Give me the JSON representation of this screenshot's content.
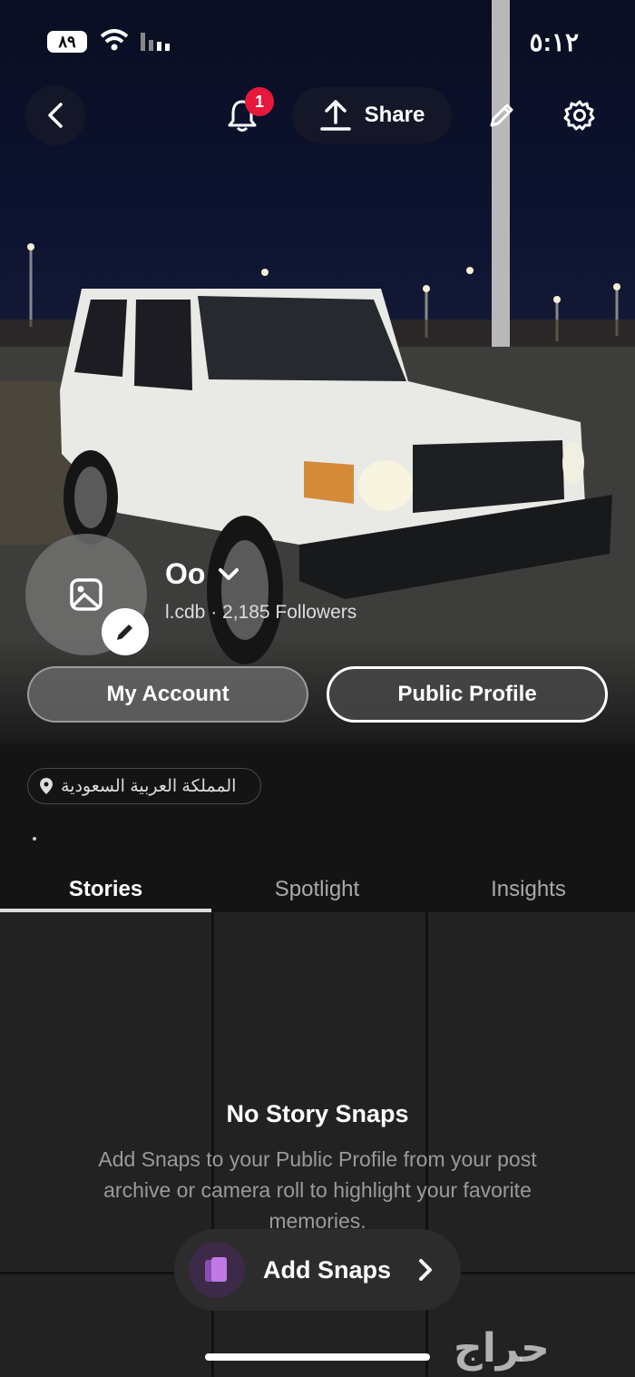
{
  "status_bar": {
    "time": "٥:١٢",
    "battery": "٨٩"
  },
  "header": {
    "notification_count": "1",
    "share_label": "Share"
  },
  "profile": {
    "name": "Oo",
    "username": "l.cdb",
    "followers": "2,185 Followers"
  },
  "buttons": {
    "my_account": "My Account",
    "public_profile": "Public Profile"
  },
  "location": {
    "text": "المملكة العربية السعودية"
  },
  "bio": ".",
  "tabs": [
    {
      "label": "Stories",
      "active": true
    },
    {
      "label": "Spotlight",
      "active": false
    },
    {
      "label": "Insights",
      "active": false
    }
  ],
  "empty_state": {
    "title": "No Story Snaps",
    "description": "Add Snaps to your Public Profile from your post archive or camera roll to highlight your favorite memories."
  },
  "add_snaps": {
    "label": "Add Snaps"
  },
  "watermark": "حراج",
  "colors": {
    "badge": "#e8183c",
    "accent_purple": "#b36bd9",
    "background": "#141414"
  }
}
